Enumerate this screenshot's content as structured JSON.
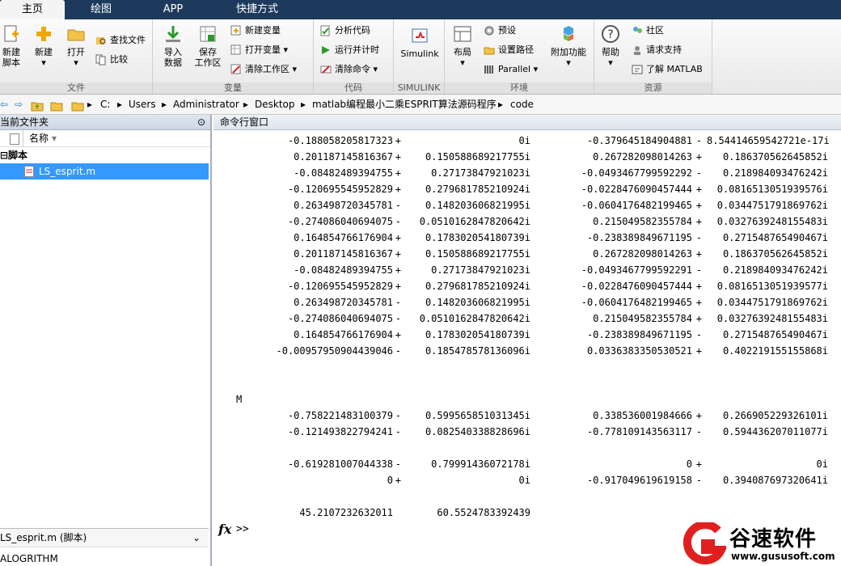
{
  "tabs": [
    "主页",
    "绘图",
    "APP",
    "快捷方式"
  ],
  "ribbon": {
    "file": {
      "label": "文件",
      "new_script": [
        "新建",
        "脚本"
      ],
      "new": "新建",
      "open": "打开",
      "find_files": "查找文件",
      "compare": "比较"
    },
    "variable": {
      "label": "变量",
      "import": [
        "导入",
        "数据"
      ],
      "save": [
        "保存",
        "工作区"
      ],
      "new_var": "新建变量",
      "open_var": "打开变量",
      "clear_ws": "清除工作区"
    },
    "code": {
      "label": "代码",
      "analyze": "分析代码",
      "run_time": "运行并计时",
      "clear_cmds": "清除命令"
    },
    "simulink": {
      "label": "SIMULINK",
      "button": "Simulink"
    },
    "env": {
      "label": "环境",
      "layout": "布局",
      "prefs": "预设",
      "set_path": "设置路径",
      "parallel": "Parallel",
      "addons": "附加功能"
    },
    "resources": {
      "label": "资源",
      "help": "帮助",
      "community": "社区",
      "support": "请求支持",
      "learn": "了解 MATLAB"
    }
  },
  "address": {
    "drive": "C:",
    "parts": [
      "Users",
      "Administrator",
      "Desktop",
      "matlab编程最小二乘ESPRIT算法源码程序",
      "code"
    ]
  },
  "left_panel": {
    "title": "当前文件夹",
    "col_name": "名称",
    "group": "脚本",
    "file": "LS_esprit.m",
    "details_title": "LS_esprit.m (脚本)",
    "details_text": "ALOGRITHM"
  },
  "command_window": {
    "title": "命令行窗口",
    "matrix_rows": [
      [
        "-0.188058205817323",
        "+",
        "0i",
        "-0.379645184904881",
        "-",
        "8.54414659542721e-17i"
      ],
      [
        "0.201187145816367",
        "+",
        "0.150588689217755i",
        "0.267282098014263",
        "+",
        "0.186370562645852i"
      ],
      [
        "-0.08482489394755",
        "+",
        "0.27173847921023i",
        "-0.0493467799592292",
        "-",
        "0.218984093476242i"
      ],
      [
        "-0.120695545952829",
        "+",
        "0.279681785210924i",
        "-0.0228476090457444",
        "+",
        "0.0816513051939576i"
      ],
      [
        "0.263498720345781",
        "-",
        "0.148203606821995i",
        "-0.0604176482199465",
        "+",
        "0.0344751791869762i"
      ],
      [
        "-0.274086040694075",
        "-",
        "0.0510162847820642i",
        "0.215049582355784",
        "+",
        "0.0327639248155483i"
      ],
      [
        "0.164854766176904",
        "+",
        "0.178302054180739i",
        "-0.238389849671195",
        "-",
        "0.271548765490467i"
      ],
      [
        "0.201187145816367",
        "+",
        "0.150588689217755i",
        "0.267282098014263",
        "+",
        "0.186370562645852i"
      ],
      [
        "-0.08482489394755",
        "+",
        "0.27173847921023i",
        "-0.0493467799592291",
        "-",
        "0.218984093476242i"
      ],
      [
        "-0.120695545952829",
        "+",
        "0.279681785210924i",
        "-0.0228476090457444",
        "+",
        "0.0816513051939577i"
      ],
      [
        "0.263498720345781",
        "-",
        "0.148203606821995i",
        "-0.0604176482199465",
        "+",
        "0.0344751791869762i"
      ],
      [
        "-0.274086040694075",
        "-",
        "0.0510162847820642i",
        "0.215049582355784",
        "+",
        "0.0327639248155483i"
      ],
      [
        "0.164854766176904",
        "+",
        "0.178302054180739i",
        "-0.238389849671195",
        "-",
        "0.271548765490467i"
      ],
      [
        "-0.00957950904439046",
        "-",
        "0.185478578136096i",
        "0.0336383350530521",
        "+",
        "0.402219155155868i"
      ]
    ],
    "var_label": "M",
    "m_rows": [
      [
        "-0.758221483100379",
        "-",
        "0.599565851031345i",
        "0.338536001984666",
        "+",
        "0.266905229326101i"
      ],
      [
        "-0.121493822794241",
        "-",
        "0.082540338828696i",
        "-0.778109143563117",
        "-",
        "0.594436207011077i"
      ]
    ],
    "d_rows": [
      [
        "-0.619281007044338",
        "-",
        "0.79991436072178i",
        "0",
        "+",
        "0i"
      ],
      [
        "0",
        "+",
        "0i",
        "-0.917049619619158",
        "-",
        "0.394087697320641i"
      ]
    ],
    "angles": [
      "45.2107232632011",
      "60.5524783392439"
    ],
    "prompt": ">>",
    "fx": "fx"
  },
  "watermark": {
    "name": "谷速软件",
    "url": "www.gususoft.com"
  },
  "colors": {
    "tabbar": "#1d3a5c",
    "selection": "#3399ff",
    "watermark_red": "#e02020"
  }
}
